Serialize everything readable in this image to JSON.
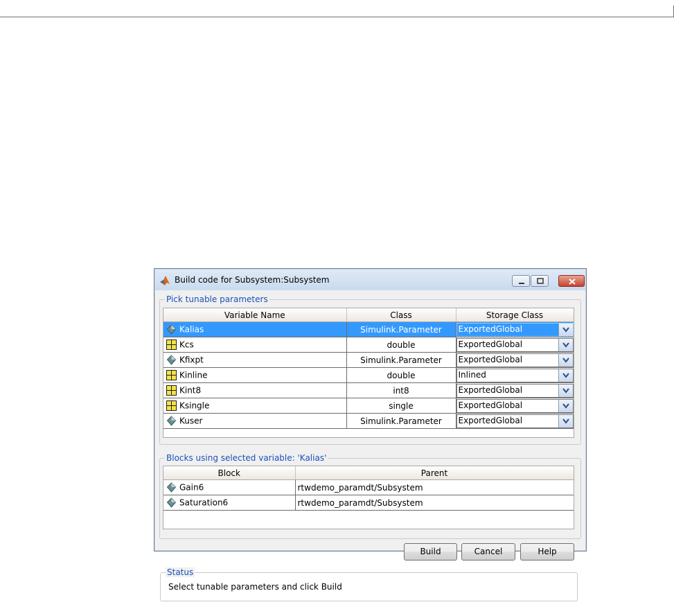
{
  "dialog": {
    "title": "Build code for Subsystem:Subsystem"
  },
  "params_group": {
    "legend": "Pick tunable parameters",
    "columns": [
      "Variable Name",
      "Class",
      "Storage Class"
    ],
    "rows": [
      {
        "icon": "parameter-object-icon",
        "name": "Kalias",
        "class": "Simulink.Parameter",
        "storage": "ExportedGlobal",
        "selected": true
      },
      {
        "icon": "numeric-variable-icon",
        "name": "Kcs",
        "class": "double",
        "storage": "ExportedGlobal"
      },
      {
        "icon": "parameter-object-icon",
        "name": "Kfixpt",
        "class": "Simulink.Parameter",
        "storage": "ExportedGlobal"
      },
      {
        "icon": "numeric-variable-icon",
        "name": "Kinline",
        "class": "double",
        "storage": "Inlined"
      },
      {
        "icon": "numeric-variable-icon",
        "name": "Kint8",
        "class": "int8",
        "storage": "ExportedGlobal"
      },
      {
        "icon": "numeric-variable-icon",
        "name": "Ksingle",
        "class": "single",
        "storage": "ExportedGlobal"
      },
      {
        "icon": "parameter-object-icon",
        "name": "Kuser",
        "class": "Simulink.Parameter",
        "storage": "ExportedGlobal"
      }
    ]
  },
  "blocks_group": {
    "legend": "Blocks using selected variable: 'Kalias'",
    "columns": [
      "Block",
      "Parent"
    ],
    "rows": [
      {
        "icon": "parameter-object-icon",
        "block": "Gain6",
        "parent": "rtwdemo_paramdt/Subsystem"
      },
      {
        "icon": "parameter-object-icon",
        "block": "Saturation6",
        "parent": "rtwdemo_paramdt/Subsystem"
      }
    ]
  },
  "buttons": {
    "build": "Build",
    "cancel": "Cancel",
    "help": "Help"
  },
  "status": {
    "legend": "Status",
    "text": "Select tunable parameters and click Build"
  },
  "colors": {
    "selection": "#3399ff",
    "legend_text": "#1a50b8"
  }
}
